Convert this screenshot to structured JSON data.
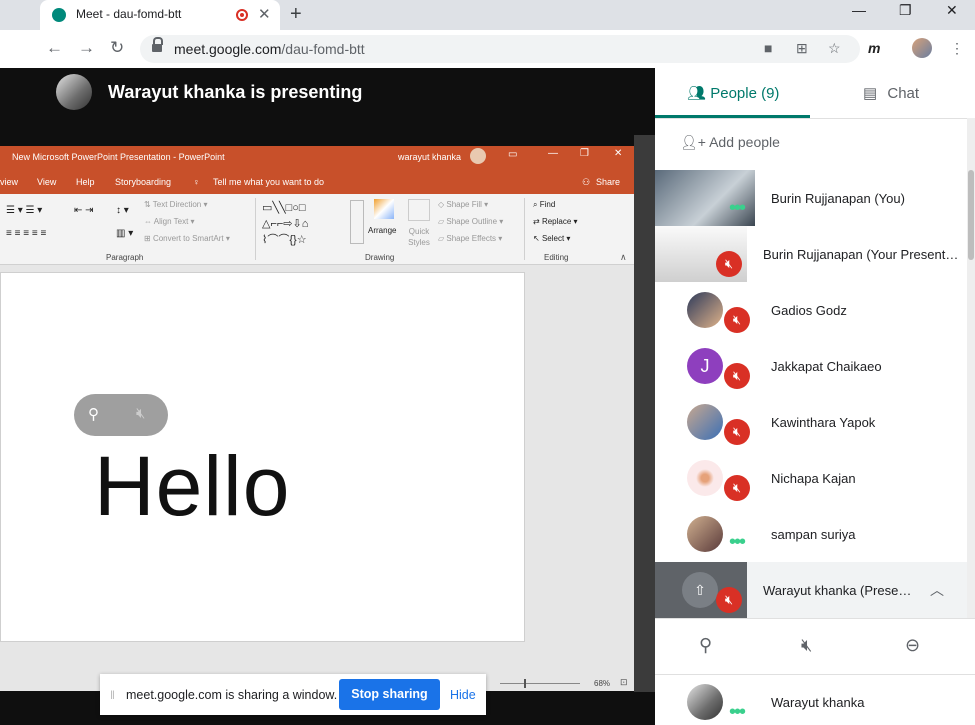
{
  "browser": {
    "tab_title": "Meet - dau-fomd-btt",
    "tab_close": "✕",
    "new_tab": "+",
    "url_domain": "meet.google.com",
    "url_path": "/dau-fomd-btt",
    "win_min": "—",
    "win_max": "❐",
    "win_close": "✕",
    "ext_m": "m"
  },
  "meet": {
    "presenting_text": "Warayut khanka is presenting",
    "share_message": "meet.google.com is sharing a window.",
    "stop_sharing": "Stop sharing",
    "hide": "Hide"
  },
  "ppt": {
    "title": "New Microsoft PowerPoint Presentation  -  PowerPoint",
    "user": "warayut khanka",
    "menu": [
      "view",
      "View",
      "Help",
      "Storyboarding",
      "Tell me what you want to do",
      "Share"
    ],
    "ribbon": {
      "text_direction": "Text Direction",
      "align_text": "Align Text",
      "convert_smartart": "Convert to SmartArt",
      "arrange": "Arrange",
      "quick_styles": "Quick Styles",
      "shape_fill": "Shape Fill",
      "shape_outline": "Shape Outline",
      "shape_effects": "Shape Effects",
      "find": "Find",
      "replace": "Replace",
      "select": "Select",
      "group_paragraph": "Paragraph",
      "group_drawing": "Drawing",
      "group_editing": "Editing"
    },
    "slide_text": "Hello",
    "zoom": "68%"
  },
  "panel": {
    "people_tab": "People (9)",
    "chat_tab": "Chat",
    "add_people": "Add people",
    "people": [
      {
        "name": "Burin Rujjanapan (You)",
        "avatar": "photo",
        "muted": false
      },
      {
        "name": "Burin Rujjanapan (Your Present…",
        "avatar": "photo",
        "muted": true
      },
      {
        "name": "Gadios Godz",
        "avatar": "photo",
        "muted": true
      },
      {
        "name": "Jakkapat Chaikaeo",
        "avatar": "J",
        "muted": true
      },
      {
        "name": "Kawinthara Yapok",
        "avatar": "photo",
        "muted": true
      },
      {
        "name": "Nichapa Kajan",
        "avatar": "photo",
        "muted": true
      },
      {
        "name": "sampan suriya",
        "avatar": "photo",
        "muted": false
      },
      {
        "name": "Warayut khanka (Prese…",
        "avatar": "present-icon",
        "muted": true
      },
      {
        "name": "Warayut khanka",
        "avatar": "photo",
        "muted": false
      }
    ]
  },
  "colors": {
    "accent": "#00796b",
    "ppt": "#c8502a",
    "mute": "#d93025",
    "blue": "#1a73e8"
  }
}
